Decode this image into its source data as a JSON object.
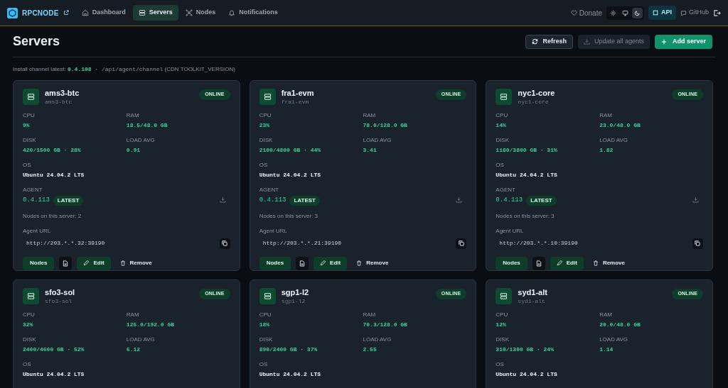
{
  "brand": {
    "name": "RPCNODE"
  },
  "nav": [
    {
      "label": "Dashboard",
      "selected": false
    },
    {
      "label": "Servers",
      "selected": true
    },
    {
      "label": "Nodes",
      "selected": false
    },
    {
      "label": "Notifications",
      "selected": false
    }
  ],
  "header_right": {
    "donate": "Donate",
    "theme": [
      {
        "selected": false
      },
      {
        "selected": false
      },
      {
        "selected": true
      }
    ],
    "api": "API",
    "github": "GitHub"
  },
  "page": {
    "title": "Servers",
    "refresh": "Refresh",
    "update_all": {
      "label": "Update all agents",
      "disabled": true
    },
    "add": "Add server",
    "channel": {
      "prefix": "Install channel latest:",
      "version": "0.4.108",
      "path": "· /api/agent/channel",
      "note": "(CDN TOOLKIT_VERSION)"
    }
  },
  "servers": [
    {
      "name": "ams3-btc",
      "host": "ams3-btc",
      "status": "ONLINE",
      "stats": [
        {
          "label": "CPU",
          "value": "9%"
        },
        {
          "label": "RAM",
          "value": "18.5/48.0 GB"
        },
        {
          "label": "DISK",
          "value": "420/1500 GB · 28%"
        },
        {
          "label": "LOAD AVG",
          "value": "0.91"
        }
      ],
      "os_label": "OS",
      "os": "Ubuntu 24.04.2 LTS",
      "agent_label": "AGENT",
      "agent": "0.4.113",
      "agent_badge": "LATEST",
      "nodes": "Nodes on this server: 2",
      "url_label": "Agent URL",
      "url": "http://203.*.*.32:39190",
      "actions": {
        "nodes": "Nodes",
        "edit": "Edit",
        "remove": "Remove"
      }
    },
    {
      "name": "fra1-evm",
      "host": "fra1-evm",
      "status": "ONLINE",
      "stats": [
        {
          "label": "CPU",
          "value": "23%"
        },
        {
          "label": "RAM",
          "value": "78.0/128.0 GB"
        },
        {
          "label": "DISK",
          "value": "2100/4800 GB · 44%"
        },
        {
          "label": "LOAD AVG",
          "value": "3.41"
        }
      ],
      "os_label": "OS",
      "os": "Ubuntu 24.04.2 LTS",
      "agent_label": "AGENT",
      "agent": "0.4.113",
      "agent_badge": "LATEST",
      "nodes": "Nodes on this server: 3",
      "url_label": "Agent URL",
      "url": "http://203.*.*.21:39190",
      "actions": {
        "nodes": "Nodes",
        "edit": "Edit",
        "remove": "Remove"
      }
    },
    {
      "name": "nyc1-core",
      "host": "nyc1-core",
      "status": "ONLINE",
      "stats": [
        {
          "label": "CPU",
          "value": "14%"
        },
        {
          "label": "RAM",
          "value": "23.0/48.0 GB"
        },
        {
          "label": "DISK",
          "value": "1180/3800 GB · 31%"
        },
        {
          "label": "LOAD AVG",
          "value": "1.82"
        }
      ],
      "os_label": "OS",
      "os": "Ubuntu 24.04.2 LTS",
      "agent_label": "AGENT",
      "agent": "0.4.113",
      "agent_badge": "LATEST",
      "nodes": "Nodes on this server: 3",
      "url_label": "Agent URL",
      "url": "http://203.*.*.10:39190",
      "actions": {
        "nodes": "Nodes",
        "edit": "Edit",
        "remove": "Remove"
      }
    },
    {
      "name": "sfo3-sol",
      "host": "sfo3-sol",
      "status": "ONLINE",
      "stats": [
        {
          "label": "CPU",
          "value": "32%"
        },
        {
          "label": "RAM",
          "value": "125.0/192.0 GB"
        },
        {
          "label": "DISK",
          "value": "2400/4600 GB · 52%"
        },
        {
          "label": "LOAD AVG",
          "value": "6.12"
        }
      ],
      "os_label": "OS",
      "os": "Ubuntu 24.04.2 LTS"
    },
    {
      "name": "sgp1-l2",
      "host": "sgp1-l2",
      "status": "ONLINE",
      "stats": [
        {
          "label": "CPU",
          "value": "18%"
        },
        {
          "label": "RAM",
          "value": "70.3/128.0 GB"
        },
        {
          "label": "DISK",
          "value": "890/2400 GB · 37%"
        },
        {
          "label": "LOAD AVG",
          "value": "2.55"
        }
      ],
      "os_label": "OS",
      "os": "Ubuntu 24.04.2 LTS"
    },
    {
      "name": "syd1-alt",
      "host": "syd1-alt",
      "status": "ONLINE",
      "stats": [
        {
          "label": "CPU",
          "value": "12%"
        },
        {
          "label": "RAM",
          "value": "20.0/48.0 GB"
        },
        {
          "label": "DISK",
          "value": "310/1300 GB · 24%"
        },
        {
          "label": "LOAD AVG",
          "value": "1.14"
        }
      ],
      "os_label": "OS",
      "os": "Ubuntu 24.04.2 LTS"
    }
  ]
}
